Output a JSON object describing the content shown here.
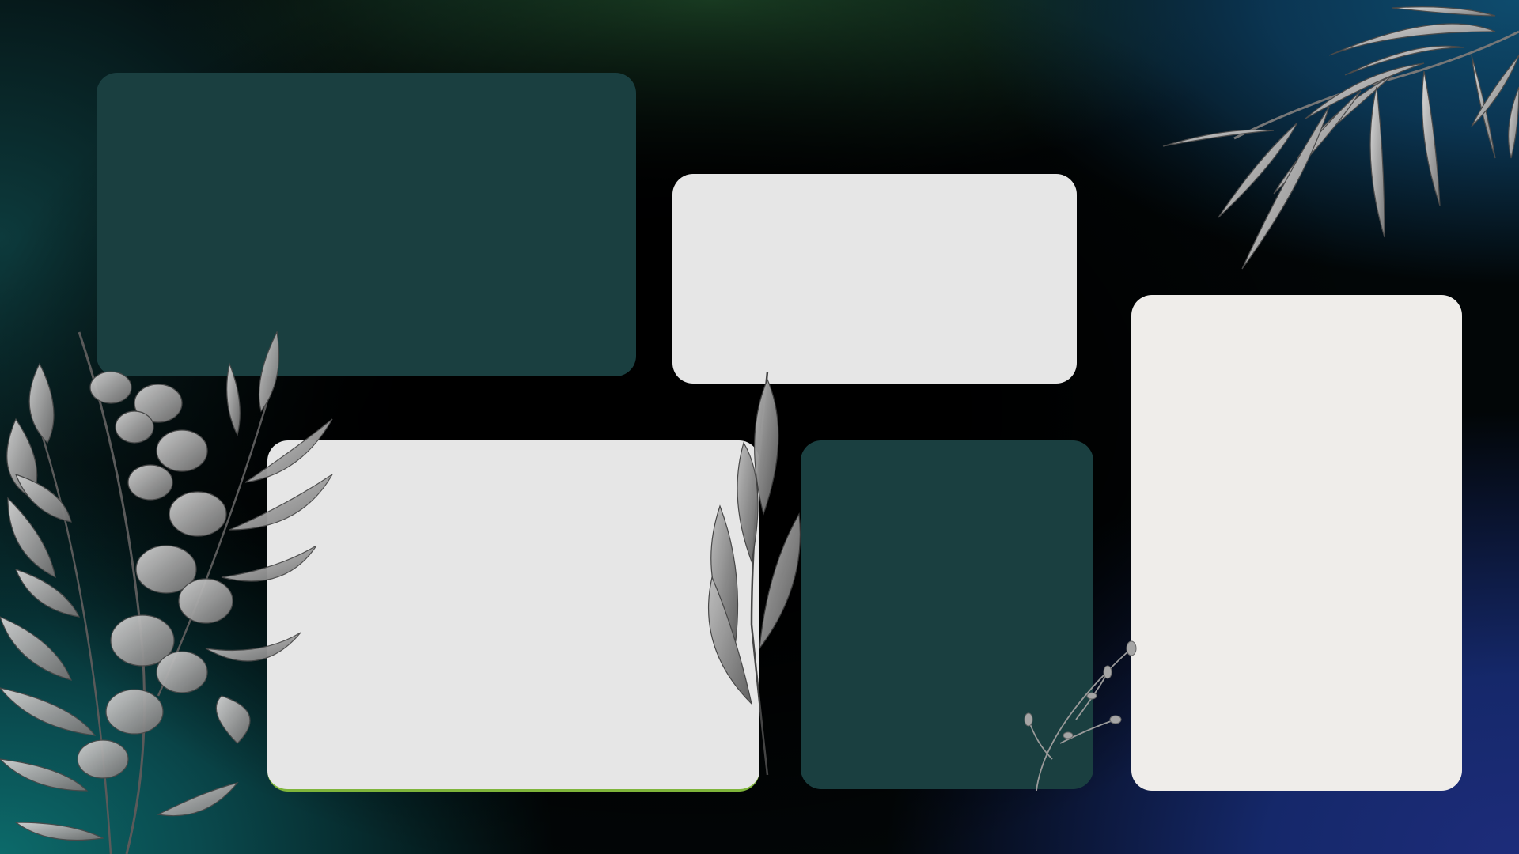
{
  "slide": {
    "panels": [
      {
        "id": "panel-1",
        "style": "dark"
      },
      {
        "id": "panel-2",
        "style": "light"
      },
      {
        "id": "panel-3",
        "style": "light"
      },
      {
        "id": "panel-4",
        "style": "dark"
      },
      {
        "id": "panel-5",
        "style": "cream"
      }
    ]
  },
  "colors": {
    "panel_dark": "#1a3f40",
    "panel_light": "#e6e6e6",
    "panel_cream": "#efedea",
    "background_center": "#000000",
    "background_bottom_left": "#0c6a6a",
    "background_bottom_right": "#1d2c7a",
    "background_top_right": "#0e4c6e",
    "background_top": "#1f4a2a",
    "foliage": "#9a9a9a"
  },
  "decorations": [
    "leaf-branch-top-right",
    "eucalyptus-cluster-left",
    "leaf-sprig-center",
    "small-sprig"
  ]
}
